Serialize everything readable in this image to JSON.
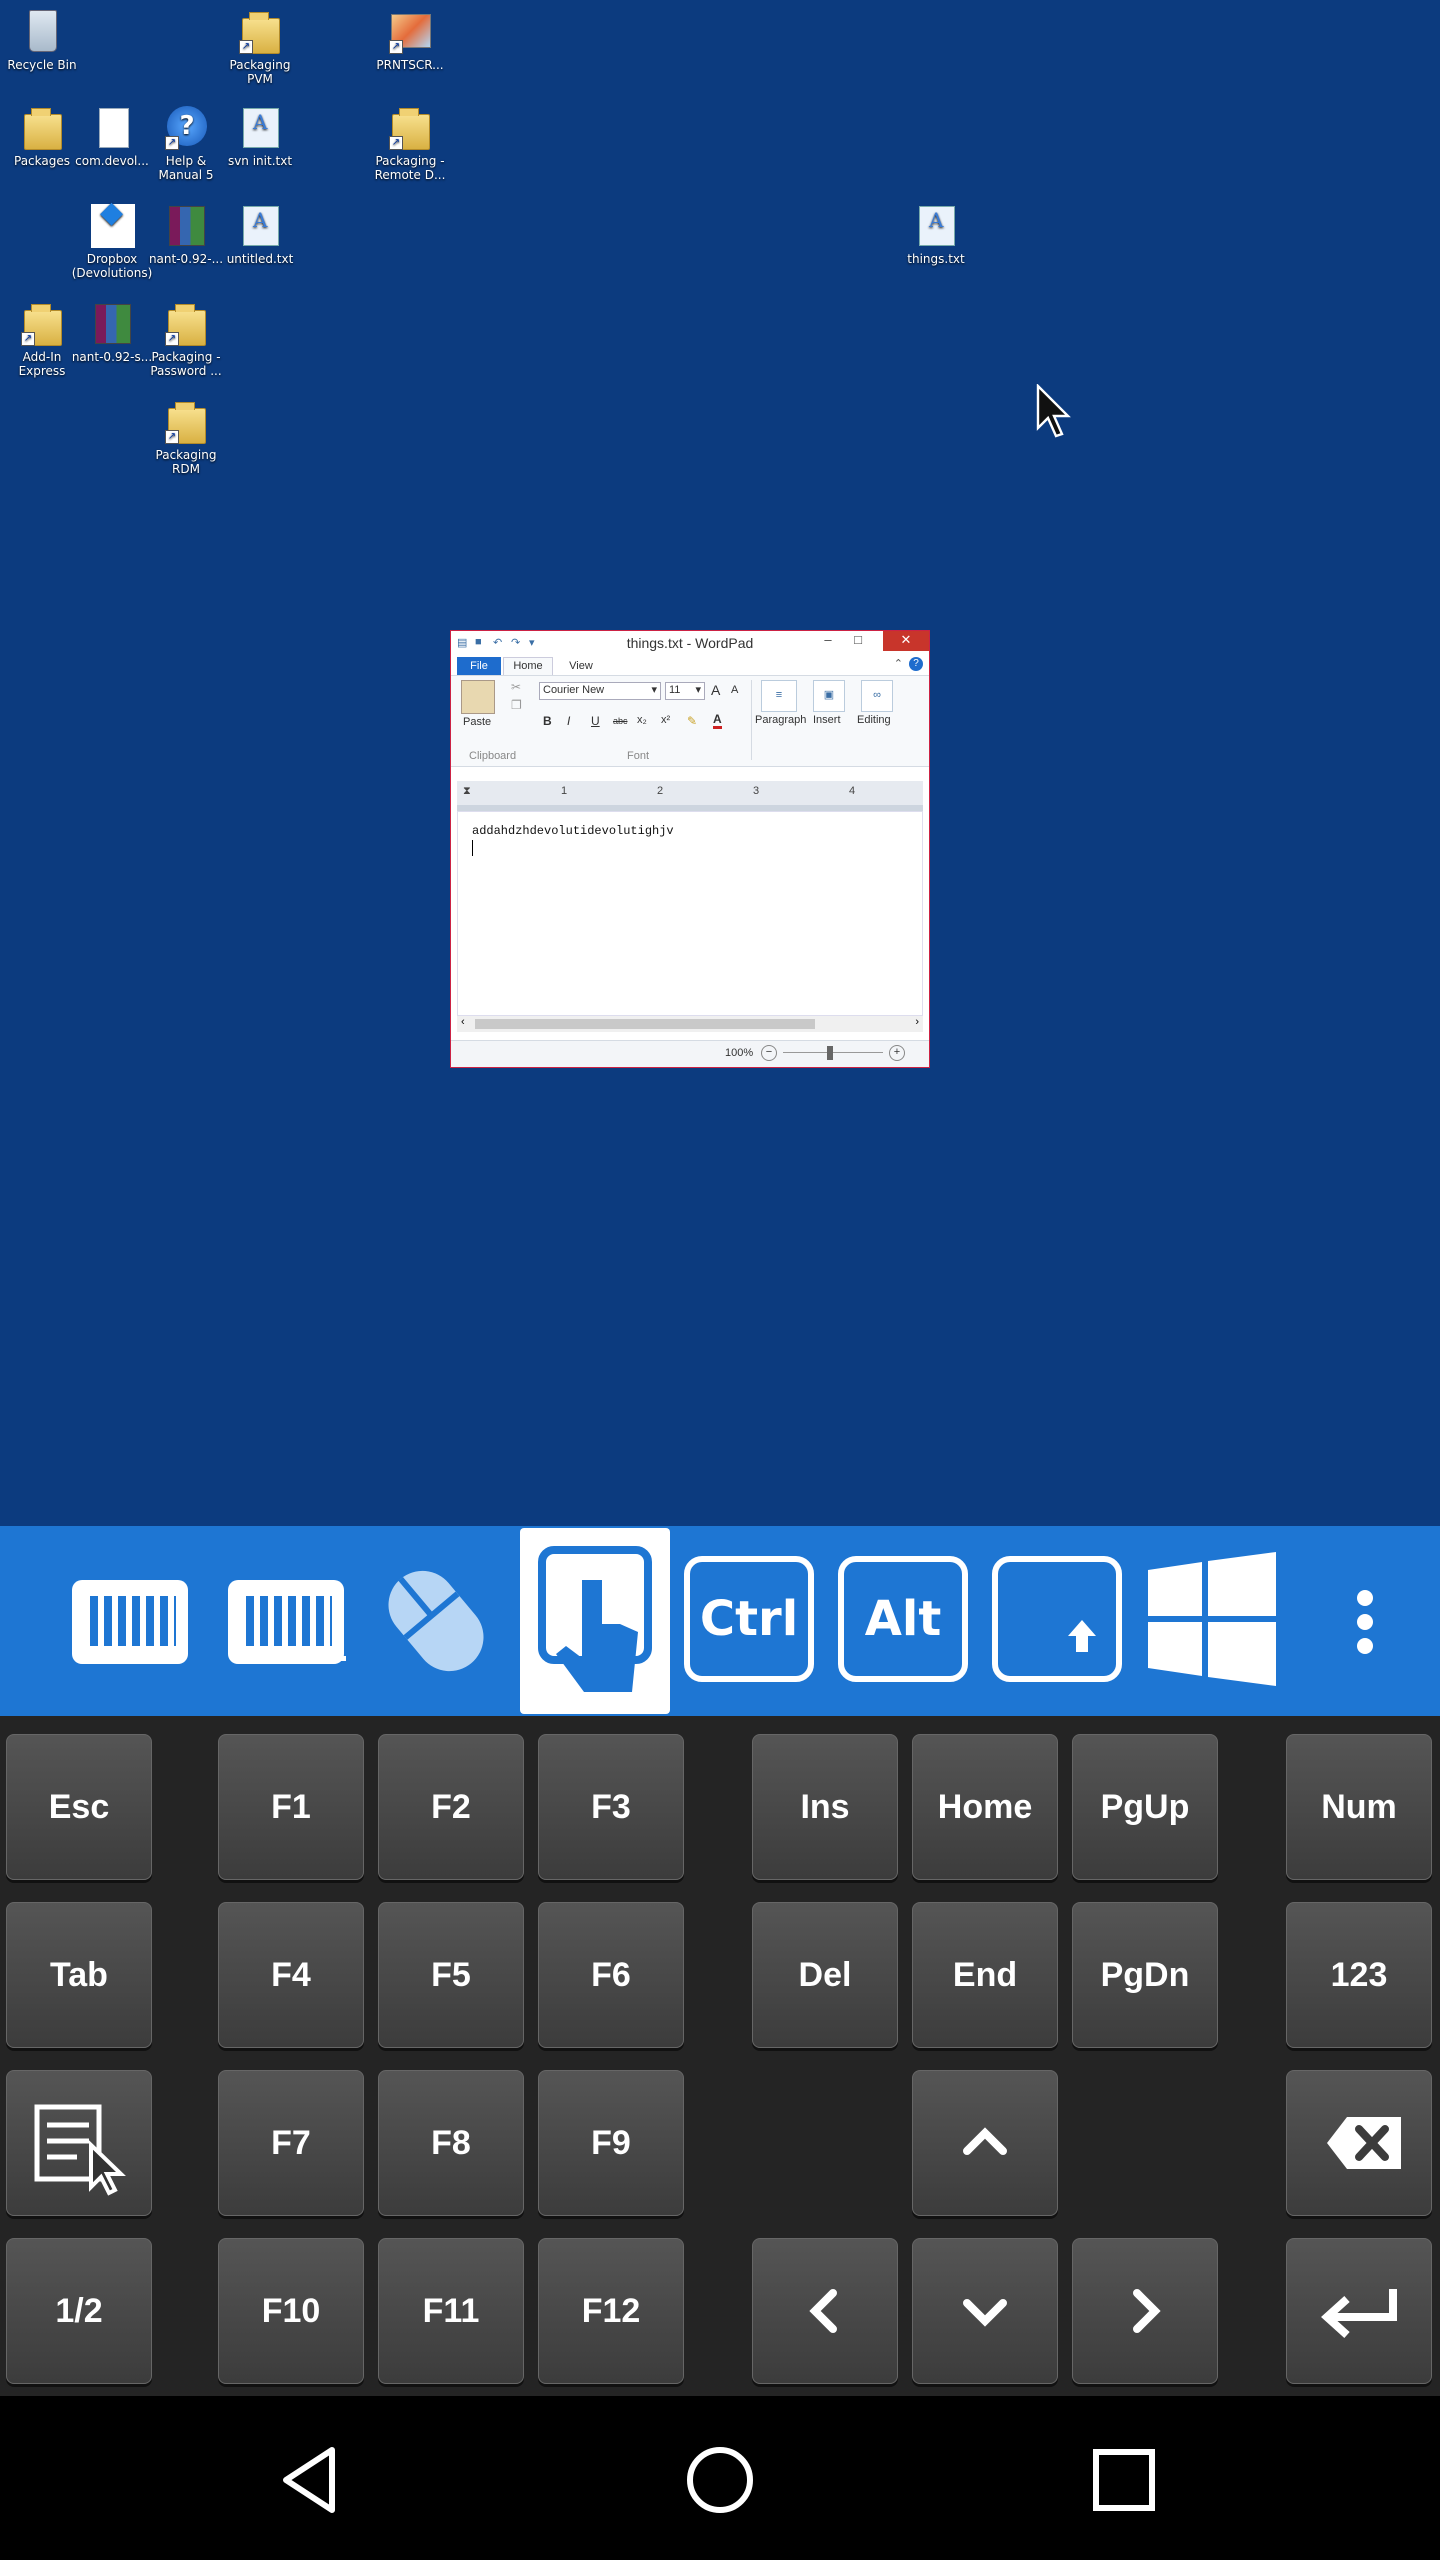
{
  "desktop": {
    "icons": [
      {
        "label": "Recycle Bin",
        "icon": "recycle-bin-icon"
      },
      {
        "label": "Packaging PVM",
        "icon": "folder-shortcut-icon"
      },
      {
        "label": "PRNTSCR...",
        "icon": "image-shortcut-icon"
      },
      {
        "label": "Packages",
        "icon": "folder-icon"
      },
      {
        "label": "com.devol...",
        "icon": "file-icon"
      },
      {
        "label": "Help & Manual 5",
        "icon": "help-manual-icon"
      },
      {
        "label": "svn init.txt",
        "icon": "text-file-icon"
      },
      {
        "label": "Packaging - Remote D...",
        "icon": "folder-shortcut-icon"
      },
      {
        "label": "Dropbox (Devolutions)",
        "icon": "dropbox-icon"
      },
      {
        "label": "nant-0.92-...",
        "icon": "archive-icon"
      },
      {
        "label": "untitled.txt",
        "icon": "text-file-icon"
      },
      {
        "label": "things.txt",
        "icon": "text-file-icon"
      },
      {
        "label": "Add-In Express",
        "icon": "folder-shortcut-icon"
      },
      {
        "label": "nant-0.92-s...",
        "icon": "archive-icon"
      },
      {
        "label": "Packaging - Password ...",
        "icon": "folder-shortcut-icon"
      },
      {
        "label": "Packaging RDM",
        "icon": "folder-shortcut-icon"
      }
    ]
  },
  "wordpad": {
    "title": "things.txt - WordPad",
    "tabs": {
      "file": "File",
      "home": "Home",
      "view": "View"
    },
    "ribbon": {
      "paste": "Paste",
      "font_name": "Courier New",
      "font_size": "11",
      "bold": "B",
      "italic": "I",
      "underline": "U",
      "strike": "abc",
      "subscript": "x₂",
      "superscript": "x²",
      "grow": "A",
      "shrink": "A",
      "paragraph": "Paragraph",
      "insert": "Insert",
      "editing": "Editing",
      "clipboard_label": "Clipboard",
      "font_label": "Font"
    },
    "ruler": {
      "marks": [
        "1",
        "2",
        "3",
        "4"
      ]
    },
    "document_text": "addahdzhdevolutidevolutighjv",
    "zoom": "100%",
    "zoom_minus": "−",
    "zoom_plus": "+"
  },
  "toolbar": {
    "buttons": [
      {
        "name": "keyboard",
        "icon": "keyboard-icon"
      },
      {
        "name": "keyboard-extended",
        "icon": "extended-keyboard-icon"
      },
      {
        "name": "mouse",
        "icon": "mouse-icon"
      },
      {
        "name": "touch",
        "icon": "touch-hand-icon",
        "active": true
      },
      {
        "name": "ctrl",
        "label": "Ctrl"
      },
      {
        "name": "alt",
        "label": "Alt"
      },
      {
        "name": "shift",
        "icon": "shift-icon"
      },
      {
        "name": "windows",
        "icon": "windows-logo-icon"
      },
      {
        "name": "more",
        "icon": "more-vertical-icon"
      }
    ]
  },
  "keyboard": {
    "rows": [
      [
        "Esc",
        "F1",
        "F2",
        "F3",
        "Ins",
        "Home",
        "PgUp",
        "Num"
      ],
      [
        "Tab",
        "F4",
        "F5",
        "F6",
        "Del",
        "End",
        "PgDn",
        "123"
      ],
      [
        "menu-icon",
        "F7",
        "F8",
        "F9",
        "up-arrow-icon",
        "backspace-icon"
      ],
      [
        "1/2",
        "F10",
        "F11",
        "F12",
        "left-arrow-icon",
        "down-arrow-icon",
        "right-arrow-icon",
        "enter-icon"
      ]
    ]
  },
  "colors": {
    "desktop": "#0c3b7f",
    "toolbar": "#1e76d3",
    "keyboard_bg": "#242424",
    "wordpad_close": "#c8352b"
  }
}
